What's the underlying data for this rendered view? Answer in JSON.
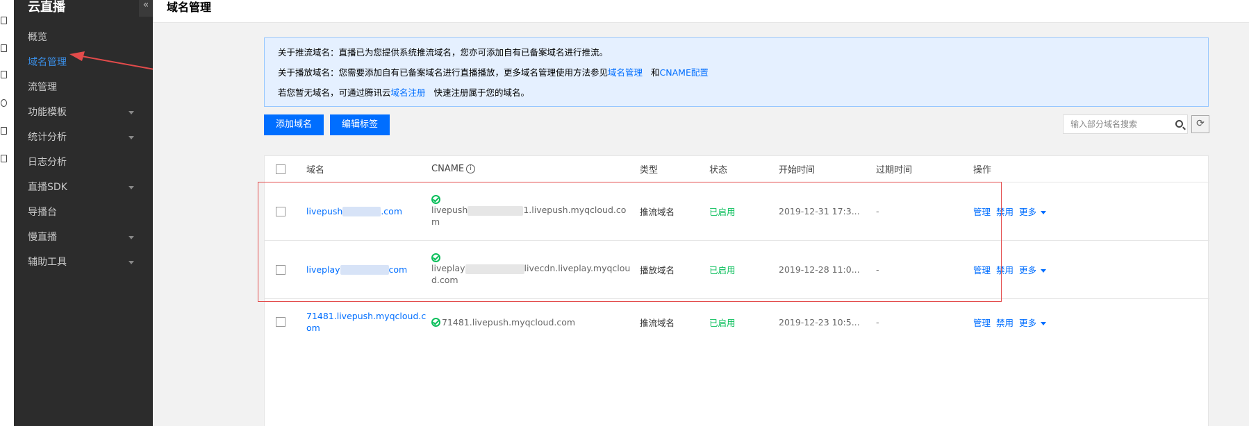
{
  "sidebar": {
    "title": "云直播",
    "collapse_glyph": "«",
    "items": [
      {
        "label": "概览",
        "active": false,
        "has_submenu": false
      },
      {
        "label": "域名管理",
        "active": true,
        "has_submenu": false
      },
      {
        "label": "流管理",
        "active": false,
        "has_submenu": false
      },
      {
        "label": "功能模板",
        "active": false,
        "has_submenu": true
      },
      {
        "label": "统计分析",
        "active": false,
        "has_submenu": true
      },
      {
        "label": "日志分析",
        "active": false,
        "has_submenu": false
      },
      {
        "label": "直播SDK",
        "active": false,
        "has_submenu": true
      },
      {
        "label": "导播台",
        "active": false,
        "has_submenu": false
      },
      {
        "label": "慢直播",
        "active": false,
        "has_submenu": true
      },
      {
        "label": "辅助工具",
        "active": false,
        "has_submenu": true
      }
    ]
  },
  "header": {
    "title": "域名管理"
  },
  "notice": {
    "line1": "关于推流域名：直播已为您提供系统推流域名，您亦可添加自有已备案域名进行推流。",
    "line2_prefix": "关于播放域名：您需要添加自有已备案域名进行直播播放，更多域名管理使用方法参见",
    "line2_link1": "域名管理",
    "line2_mid": "和",
    "line2_link2": "CNAME配置",
    "line3_prefix": "若您暂无域名，可通过腾讯云",
    "line3_link": "域名注册",
    "line3_suffix": "快速注册属于您的域名。"
  },
  "toolbar": {
    "add_domain_label": "添加域名",
    "edit_tags_label": "编辑标签",
    "search_placeholder": "输入部分域名搜索"
  },
  "table": {
    "headers": {
      "domain": "域名",
      "cname": "CNAME",
      "type": "类型",
      "status": "状态",
      "start_time": "开始时间",
      "expire_time": "过期时间",
      "actions": "操作"
    },
    "rows": [
      {
        "domain_start": "livepush",
        "domain_end": ".com",
        "cname_line1": "livepush",
        "cname_line1_end": "1.livepush.myqcloud.co",
        "cname_line2": "m",
        "type": "推流域名",
        "status": "已启用",
        "start_time": "2019-12-31 17:3...",
        "expire_time": "-",
        "action_manage": "管理",
        "action_disable": "禁用",
        "action_more": "更多"
      },
      {
        "domain_start": "liveplay",
        "domain_end": "com",
        "cname_line1": "liveplay",
        "cname_line1_end": "livecdn.liveplay.myqclou",
        "cname_line2": "d.com",
        "type": "播放域名",
        "status": "已启用",
        "start_time": "2019-12-28 11:0...",
        "expire_time": "-",
        "action_manage": "管理",
        "action_disable": "禁用",
        "action_more": "更多"
      },
      {
        "domain_line1": "71481.livepush.myqcloud.c",
        "domain_line2": "om",
        "cname": "71481.livepush.myqcloud.com",
        "type": "推流域名",
        "status": "已启用",
        "start_time": "2019-12-23 10:5...",
        "expire_time": "-",
        "action_manage": "管理",
        "action_disable": "禁用",
        "action_more": "更多"
      }
    ]
  },
  "colors": {
    "sidebar_bg": "#2c2c2c",
    "accent": "#006eff",
    "status_on": "#0abf5b",
    "annotation_red": "#e34b4b"
  }
}
